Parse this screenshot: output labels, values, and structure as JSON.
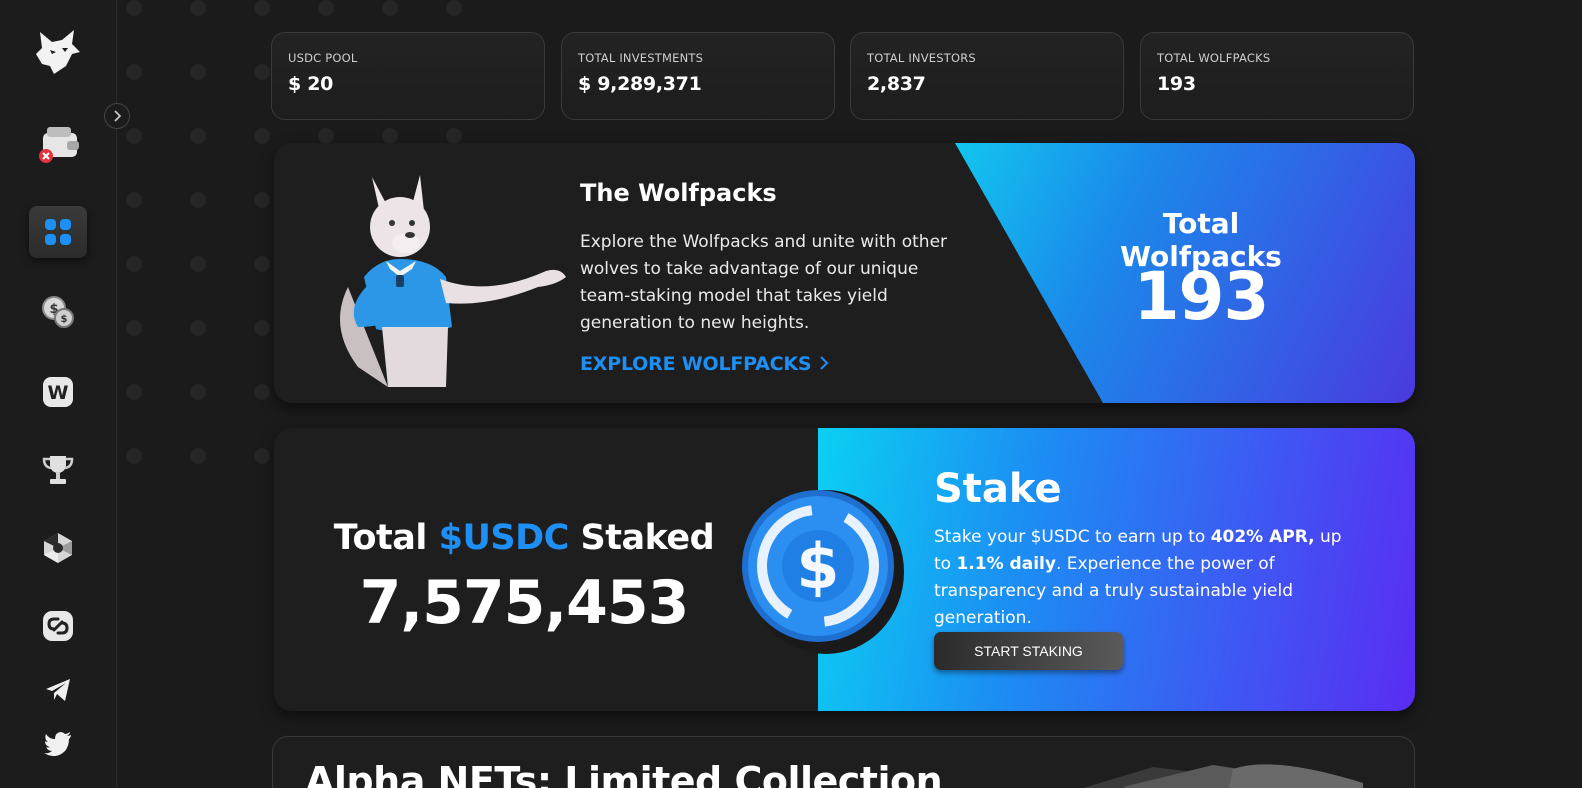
{
  "stats": [
    {
      "label": "USDC POOL",
      "value": "$ 20"
    },
    {
      "label": "TOTAL INVESTMENTS",
      "value": "$ 9,289,371"
    },
    {
      "label": "TOTAL INVESTORS",
      "value": "2,837"
    },
    {
      "label": "TOTAL WOLFPACKS",
      "value": "193"
    }
  ],
  "wolfpacks": {
    "title": "The Wolfpacks",
    "description": "Explore the Wolfpacks and unite with other wolves to take advantage of our unique team-staking model that takes yield generation to new heights.",
    "link": "EXPLORE WOLFPACKS",
    "stat_label": "Total Wolfpacks",
    "stat_value": "193"
  },
  "stake": {
    "total_prefix": "Total",
    "total_accent": "$USDC",
    "total_suffix": "Staked",
    "total_value": "7,575,453",
    "title": "Stake",
    "desc_1": "Stake your $USDC to earn up to ",
    "desc_bold_1": "402% APR,",
    "desc_2": " up to ",
    "desc_bold_2": "1.1% daily",
    "desc_3": ". Experience the power of transparency and a truly sustainable yield generation.",
    "button": "START STAKING"
  },
  "alpha": {
    "title": "Alpha NFTs: Limited Collection"
  },
  "sidebar": {
    "items": [
      "wolf-logo-icon",
      "wallet-icon",
      "dashboard-icon",
      "coins-icon",
      "wolfpacks-w-icon",
      "trophy-icon",
      "cube-icon",
      "link-icon",
      "telegram-icon",
      "twitter-icon"
    ]
  },
  "colors": {
    "accent": "#1e8ff5",
    "background": "#1b1b1b",
    "gradient_start": "#12c6ef",
    "gradient_end": "#5a2cf3"
  }
}
